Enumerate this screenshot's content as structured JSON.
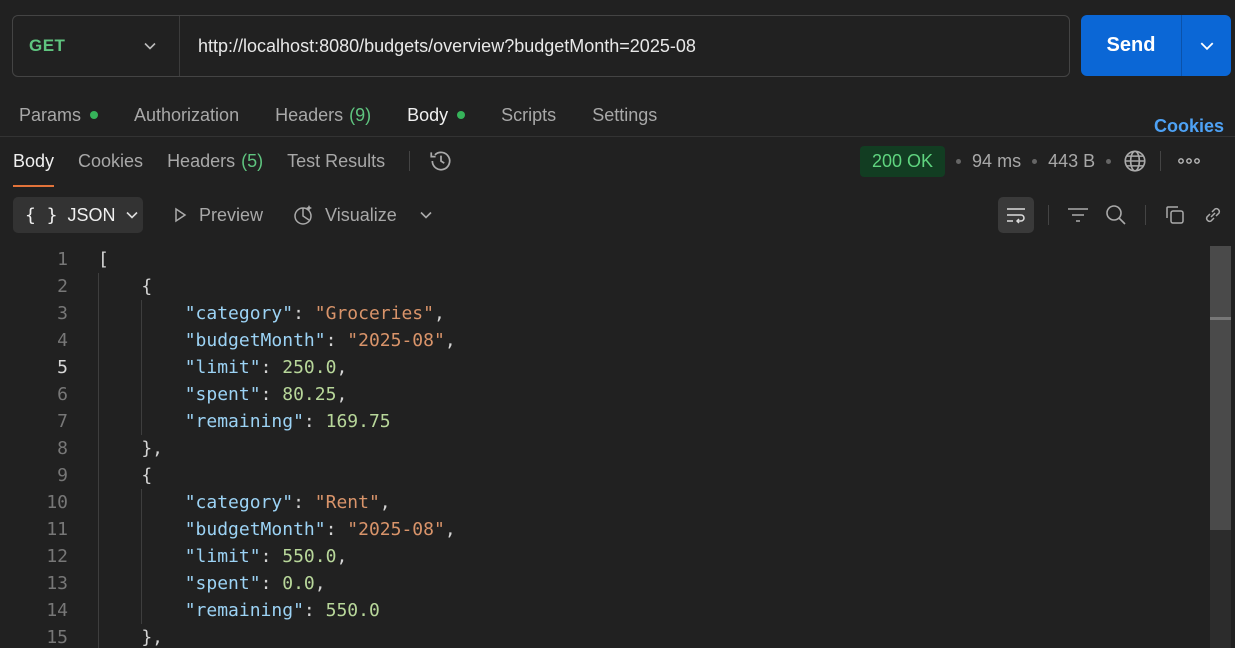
{
  "request": {
    "method": "GET",
    "url": "http://localhost:8080/budgets/overview?budgetMonth=2025-08",
    "send_label": "Send"
  },
  "request_tabs": [
    {
      "label": "Params",
      "dot": true
    },
    {
      "label": "Authorization"
    },
    {
      "label": "Headers",
      "count": "(9)"
    },
    {
      "label": "Body",
      "dot": true,
      "active": true
    },
    {
      "label": "Scripts"
    },
    {
      "label": "Settings"
    }
  ],
  "cookies_link": "Cookies",
  "response_tabs": [
    {
      "label": "Body",
      "active": true
    },
    {
      "label": "Cookies"
    },
    {
      "label": "Headers",
      "count": "(5)"
    },
    {
      "label": "Test Results"
    }
  ],
  "status": {
    "code": "200 OK",
    "time": "94 ms",
    "size": "443 B"
  },
  "toolbar": {
    "format": "JSON",
    "preview": "Preview",
    "visualize": "Visualize"
  },
  "code_lines": [
    "[",
    "    {",
    "        \"category\": \"Groceries\",",
    "        \"budgetMonth\": \"2025-08\",",
    "        \"limit\": 250.0,",
    "        \"spent\": 80.25,",
    "        \"remaining\": 169.75",
    "    },",
    "    {",
    "        \"category\": \"Rent\",",
    "        \"budgetMonth\": \"2025-08\",",
    "        \"limit\": 550.0,",
    "        \"spent\": 0.0,",
    "        \"remaining\": 550.0",
    "    },"
  ],
  "line_numbers": [
    "1",
    "2",
    "3",
    "4",
    "5",
    "6",
    "7",
    "8",
    "9",
    "10",
    "11",
    "12",
    "13",
    "14",
    "15"
  ],
  "colors": {
    "accent": "#0b67d6",
    "method": "#5fc47f",
    "status_bg": "#123d22",
    "tab_underline": "#e2733a"
  }
}
